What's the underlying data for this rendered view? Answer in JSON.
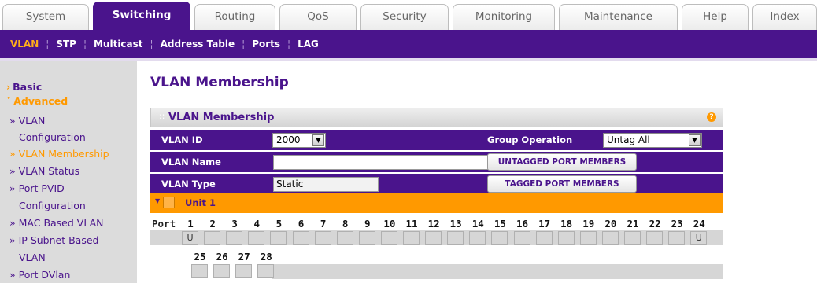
{
  "tabs": [
    {
      "label": "System",
      "active": false
    },
    {
      "label": "Switching",
      "active": true
    },
    {
      "label": "Routing",
      "active": false
    },
    {
      "label": "QoS",
      "active": false
    },
    {
      "label": "Security",
      "active": false
    },
    {
      "label": "Monitoring",
      "active": false
    },
    {
      "label": "Maintenance",
      "active": false
    },
    {
      "label": "Help",
      "active": false
    },
    {
      "label": "Index",
      "active": false
    }
  ],
  "submenu": [
    {
      "label": "VLAN",
      "active": true
    },
    {
      "label": "STP",
      "active": false
    },
    {
      "label": "Multicast",
      "active": false
    },
    {
      "label": "Address Table",
      "active": false
    },
    {
      "label": "Ports",
      "active": false
    },
    {
      "label": "LAG",
      "active": false
    }
  ],
  "leftnav": {
    "basic": "Basic",
    "advanced": "Advanced",
    "items": [
      {
        "lines": [
          "» VLAN",
          "Configuration"
        ]
      },
      {
        "lines": [
          "» VLAN Membership"
        ],
        "selected": true
      },
      {
        "lines": [
          "» VLAN Status"
        ]
      },
      {
        "lines": [
          "» Port PVID",
          "Configuration"
        ]
      },
      {
        "lines": [
          "» MAC Based VLAN"
        ]
      },
      {
        "lines": [
          "» IP Subnet Based",
          "VLAN"
        ]
      },
      {
        "lines": [
          "» Port DVlan"
        ]
      }
    ]
  },
  "page_title": "VLAN Membership",
  "panel": {
    "title": "VLAN Membership",
    "help": "?",
    "vlan_id_label": "VLAN ID",
    "vlan_id_value": "2000",
    "group_op_label": "Group Operation",
    "group_op_value": "Untag All",
    "vlan_name_label": "VLAN Name",
    "vlan_name_value": "",
    "vlan_type_label": "VLAN Type",
    "vlan_type_value": "Static",
    "untagged_btn": "UNTAGGED PORT MEMBERS",
    "tagged_btn": "TAGGED PORT MEMBERS"
  },
  "unit": {
    "label": "Unit 1"
  },
  "ports": {
    "label": "Port",
    "row1": [
      "1",
      "2",
      "3",
      "4",
      "5",
      "6",
      "7",
      "8",
      "9",
      "10",
      "11",
      "12",
      "13",
      "14",
      "15",
      "16",
      "17",
      "18",
      "19",
      "20",
      "21",
      "22",
      "23",
      "24"
    ],
    "row1_states": [
      "U",
      "",
      "",
      "",
      "",
      "",
      "",
      "",
      "",
      "",
      "",
      "",
      "",
      "",
      "",
      "",
      "",
      "",
      "",
      "",
      "",
      "",
      "",
      "U"
    ],
    "row2": [
      "25",
      "26",
      "27",
      "28"
    ],
    "row2_states": [
      "",
      "",
      "",
      ""
    ]
  },
  "colors": {
    "primary": "#4a148c",
    "accent": "#ff9900",
    "sidebar": "#dcdcdc"
  }
}
